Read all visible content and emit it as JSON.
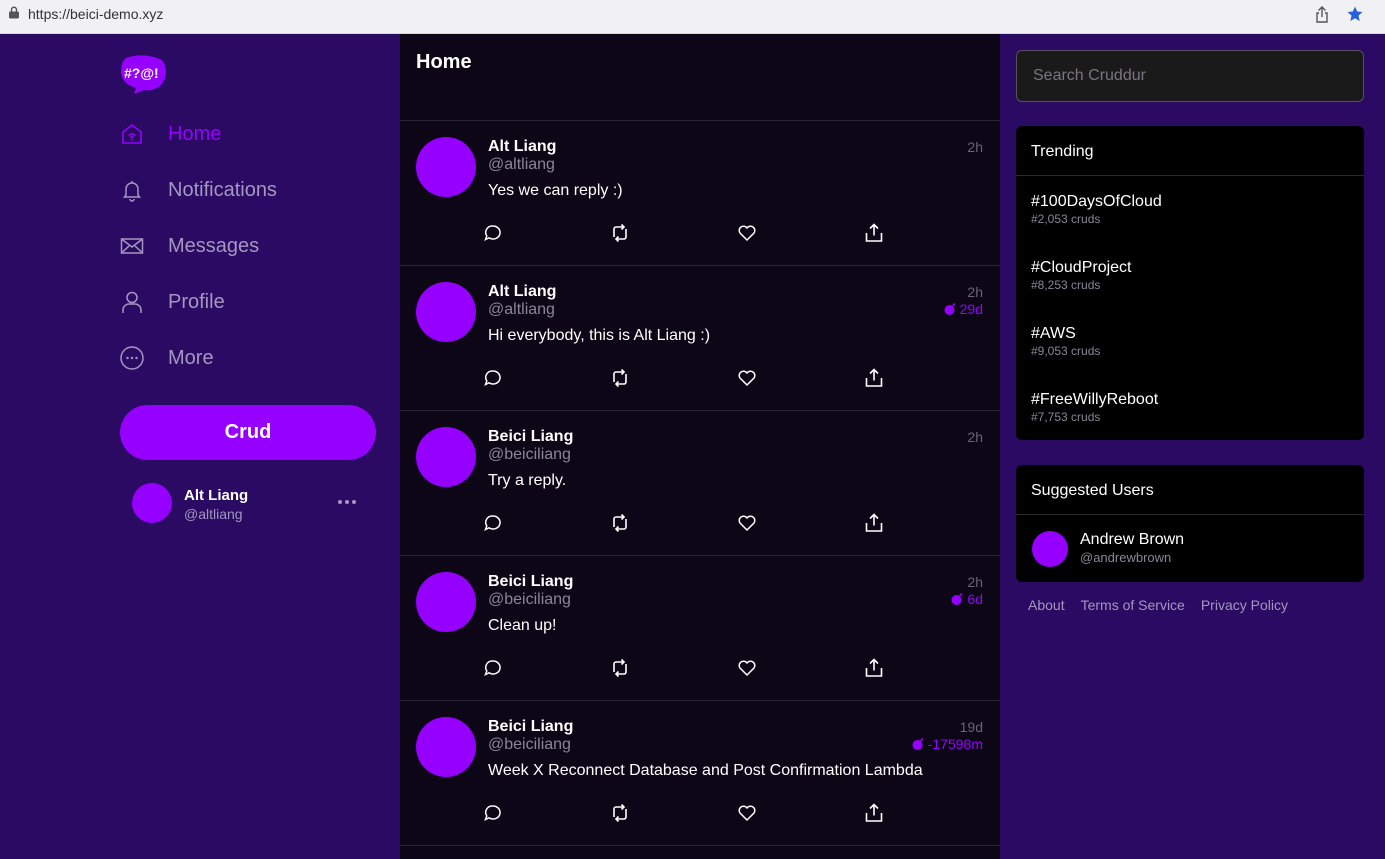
{
  "browser": {
    "url": "https://beici-demo.xyz"
  },
  "sidebar": {
    "logo_text": "#?@!",
    "items": [
      {
        "label": "Home",
        "icon": "home-icon",
        "active": true
      },
      {
        "label": "Notifications",
        "icon": "bell-icon",
        "active": false
      },
      {
        "label": "Messages",
        "icon": "envelope-icon",
        "active": false
      },
      {
        "label": "Profile",
        "icon": "user-icon",
        "active": false
      },
      {
        "label": "More",
        "icon": "more-icon",
        "active": false
      }
    ],
    "crud_label": "Crud",
    "profile": {
      "name": "Alt Liang",
      "handle": "@altliang"
    }
  },
  "feed": {
    "title": "Home",
    "activities": [
      {
        "name": "Alt Liang",
        "handle": "@altliang",
        "message": "Yes we can reply :)",
        "time": "2h",
        "expires": ""
      },
      {
        "name": "Alt Liang",
        "handle": "@altliang",
        "message": "Hi everybody, this is Alt Liang :)",
        "time": "2h",
        "expires": "29d"
      },
      {
        "name": "Beici Liang",
        "handle": "@beiciliang",
        "message": "Try a reply.",
        "time": "2h",
        "expires": ""
      },
      {
        "name": "Beici Liang",
        "handle": "@beiciliang",
        "message": "Clean up!",
        "time": "2h",
        "expires": "6d"
      },
      {
        "name": "Beici Liang",
        "handle": "@beiciliang",
        "message": "Week X Reconnect Database and Post Confirmation Lambda",
        "time": "19d",
        "expires": "-17598m"
      }
    ]
  },
  "right": {
    "search_placeholder": "Search Cruddur",
    "trending_title": "Trending",
    "trending": [
      {
        "tag": "#100DaysOfCloud",
        "count": "#2,053 cruds"
      },
      {
        "tag": "#CloudProject",
        "count": "#8,253 cruds"
      },
      {
        "tag": "#AWS",
        "count": "#9,053 cruds"
      },
      {
        "tag": "#FreeWillyReboot",
        "count": "#7,753 cruds"
      }
    ],
    "suggested_title": "Suggested Users",
    "suggested": [
      {
        "name": "Andrew Brown",
        "handle": "@andrewbrown"
      }
    ],
    "footer": [
      "About",
      "Terms of Service",
      "Privacy Policy"
    ]
  },
  "colors": {
    "accent": "#9500ff",
    "sidebar_bg": "#2a0a62",
    "feed_bg": "#0d0617"
  }
}
